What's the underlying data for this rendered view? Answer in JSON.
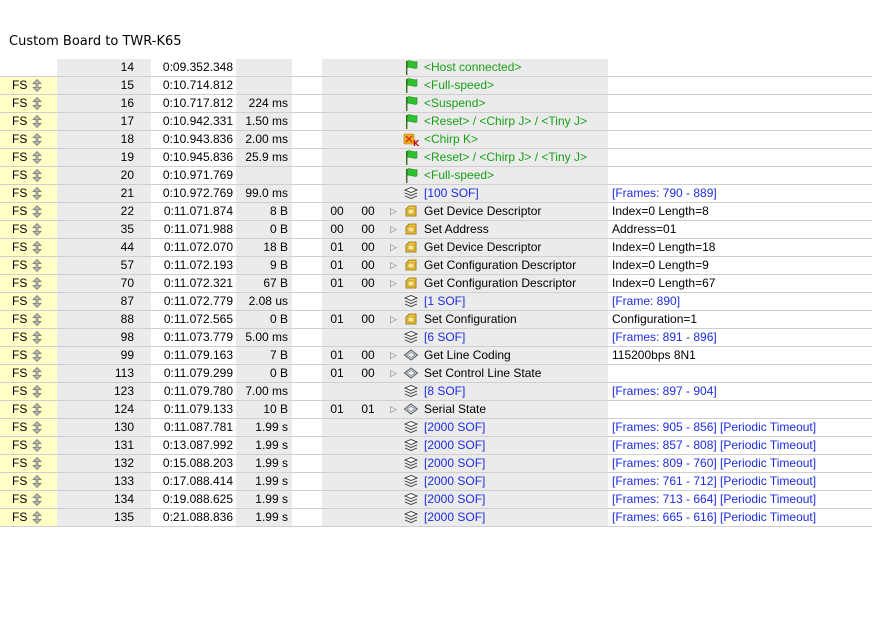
{
  "title": "Custom Board to TWR-K65",
  "rows": [
    {
      "sp": "",
      "idx": "14",
      "time": "0:09.352.348",
      "dur": "",
      "dev": "",
      "ep": "",
      "exp": false,
      "icon": "flag-icon",
      "rec": "<Host connected>",
      "recColor": "green",
      "sum": "",
      "sumColor": "black"
    },
    {
      "sp": "FS",
      "idx": "15",
      "time": "0:10.714.812",
      "dur": "",
      "dev": "",
      "ep": "",
      "exp": false,
      "icon": "flag-icon",
      "rec": "<Full-speed>",
      "recColor": "green",
      "sum": "",
      "sumColor": "black"
    },
    {
      "sp": "FS",
      "idx": "16",
      "time": "0:10.717.812",
      "dur": "224 ms",
      "dev": "",
      "ep": "",
      "exp": false,
      "icon": "flag-icon",
      "rec": "<Suspend>",
      "recColor": "green",
      "sum": "",
      "sumColor": "black"
    },
    {
      "sp": "FS",
      "idx": "17",
      "time": "0:10.942.331",
      "dur": "1.50 ms",
      "dev": "",
      "ep": "",
      "exp": false,
      "icon": "flag-icon",
      "rec": "<Reset> / <Chirp J> / <Tiny J>",
      "recColor": "green",
      "sum": "",
      "sumColor": "black"
    },
    {
      "sp": "FS",
      "idx": "18",
      "time": "0:10.943.836",
      "dur": "2.00 ms",
      "dev": "",
      "ep": "",
      "exp": false,
      "icon": "chirp-k-icon",
      "rec": "<Chirp K>",
      "recColor": "green",
      "sum": "",
      "sumColor": "black"
    },
    {
      "sp": "FS",
      "idx": "19",
      "time": "0:10.945.836",
      "dur": "25.9 ms",
      "dev": "",
      "ep": "",
      "exp": false,
      "icon": "flag-icon",
      "rec": "<Reset> / <Chirp J> / <Tiny J>",
      "recColor": "green",
      "sum": "",
      "sumColor": "black"
    },
    {
      "sp": "FS",
      "idx": "20",
      "time": "0:10.971.769",
      "dur": "",
      "dev": "",
      "ep": "",
      "exp": false,
      "icon": "flag-icon",
      "rec": "<Full-speed>",
      "recColor": "green",
      "sum": "",
      "sumColor": "black"
    },
    {
      "sp": "FS",
      "idx": "21",
      "time": "0:10.972.769",
      "dur": "99.0 ms",
      "dev": "",
      "ep": "",
      "exp": false,
      "icon": "sof-stack-icon",
      "rec": "[100 SOF]",
      "recColor": "blue",
      "sum": "[Frames: 790 - 889]",
      "sumColor": "blue"
    },
    {
      "sp": "FS",
      "idx": "22",
      "time": "0:11.071.874",
      "dur": "8 B",
      "dev": "00",
      "ep": "00",
      "exp": true,
      "icon": "control-transfer-icon",
      "rec": "Get Device Descriptor",
      "recColor": "black",
      "sum": "Index=0 Length=8",
      "sumColor": "black"
    },
    {
      "sp": "FS",
      "idx": "35",
      "time": "0:11.071.988",
      "dur": "0 B",
      "dev": "00",
      "ep": "00",
      "exp": true,
      "icon": "control-transfer-icon",
      "rec": "Set Address",
      "recColor": "black",
      "sum": "Address=01",
      "sumColor": "black"
    },
    {
      "sp": "FS",
      "idx": "44",
      "time": "0:11.072.070",
      "dur": "18 B",
      "dev": "01",
      "ep": "00",
      "exp": true,
      "icon": "control-transfer-icon",
      "rec": "Get Device Descriptor",
      "recColor": "black",
      "sum": "Index=0 Length=18",
      "sumColor": "black"
    },
    {
      "sp": "FS",
      "idx": "57",
      "time": "0:11.072.193",
      "dur": "9 B",
      "dev": "01",
      "ep": "00",
      "exp": true,
      "icon": "control-transfer-icon",
      "rec": "Get Configuration Descriptor",
      "recColor": "black",
      "sum": "Index=0 Length=9",
      "sumColor": "black"
    },
    {
      "sp": "FS",
      "idx": "70",
      "time": "0:11.072.321",
      "dur": "67 B",
      "dev": "01",
      "ep": "00",
      "exp": true,
      "icon": "control-transfer-icon",
      "rec": "Get Configuration Descriptor",
      "recColor": "black",
      "sum": "Index=0 Length=67",
      "sumColor": "black"
    },
    {
      "sp": "FS",
      "idx": "87",
      "time": "0:11.072.779",
      "dur": "2.08 us",
      "dev": "",
      "ep": "",
      "exp": false,
      "icon": "sof-stack-icon",
      "rec": "[1 SOF]",
      "recColor": "blue",
      "sum": "[Frame: 890]",
      "sumColor": "blue"
    },
    {
      "sp": "FS",
      "idx": "88",
      "time": "0:11.072.565",
      "dur": "0 B",
      "dev": "01",
      "ep": "00",
      "exp": true,
      "icon": "control-transfer-icon",
      "rec": "Set Configuration",
      "recColor": "black",
      "sum": "Configuration=1",
      "sumColor": "black"
    },
    {
      "sp": "FS",
      "idx": "98",
      "time": "0:11.073.779",
      "dur": "5.00 ms",
      "dev": "",
      "ep": "",
      "exp": false,
      "icon": "sof-stack-icon",
      "rec": "[6 SOF]",
      "recColor": "blue",
      "sum": "[Frames: 891 - 896]",
      "sumColor": "blue"
    },
    {
      "sp": "FS",
      "idx": "99",
      "time": "0:11.079.163",
      "dur": "7 B",
      "dev": "01",
      "ep": "00",
      "exp": true,
      "icon": "class-request-icon",
      "rec": "Get Line Coding",
      "recColor": "black",
      "sum": "115200bps 8N1",
      "sumColor": "black"
    },
    {
      "sp": "FS",
      "idx": "113",
      "time": "0:11.079.299",
      "dur": "0 B",
      "dev": "01",
      "ep": "00",
      "exp": true,
      "icon": "class-request-icon",
      "rec": "Set Control Line State",
      "recColor": "black",
      "sum": "",
      "sumColor": "black"
    },
    {
      "sp": "FS",
      "idx": "123",
      "time": "0:11.079.780",
      "dur": "7.00 ms",
      "dev": "",
      "ep": "",
      "exp": false,
      "icon": "sof-stack-icon",
      "rec": "[8 SOF]",
      "recColor": "blue",
      "sum": "[Frames: 897 - 904]",
      "sumColor": "blue"
    },
    {
      "sp": "FS",
      "idx": "124",
      "time": "0:11.079.133",
      "dur": "10 B",
      "dev": "01",
      "ep": "01",
      "exp": true,
      "icon": "class-request-icon",
      "rec": "Serial State",
      "recColor": "black",
      "sum": "",
      "sumColor": "black"
    },
    {
      "sp": "FS",
      "idx": "130",
      "time": "0:11.087.781",
      "dur": "1.99 s",
      "dev": "",
      "ep": "",
      "exp": false,
      "icon": "sof-stack-icon",
      "rec": "[2000 SOF]",
      "recColor": "blue",
      "sum": "[Frames: 905 - 856] [Periodic Timeout]",
      "sumColor": "blue"
    },
    {
      "sp": "FS",
      "idx": "131",
      "time": "0:13.087.992",
      "dur": "1.99 s",
      "dev": "",
      "ep": "",
      "exp": false,
      "icon": "sof-stack-icon",
      "rec": "[2000 SOF]",
      "recColor": "blue",
      "sum": "[Frames: 857 - 808] [Periodic Timeout]",
      "sumColor": "blue"
    },
    {
      "sp": "FS",
      "idx": "132",
      "time": "0:15.088.203",
      "dur": "1.99 s",
      "dev": "",
      "ep": "",
      "exp": false,
      "icon": "sof-stack-icon",
      "rec": "[2000 SOF]",
      "recColor": "blue",
      "sum": "[Frames: 809 - 760] [Periodic Timeout]",
      "sumColor": "blue"
    },
    {
      "sp": "FS",
      "idx": "133",
      "time": "0:17.088.414",
      "dur": "1.99 s",
      "dev": "",
      "ep": "",
      "exp": false,
      "icon": "sof-stack-icon",
      "rec": "[2000 SOF]",
      "recColor": "blue",
      "sum": "[Frames: 761 - 712] [Periodic Timeout]",
      "sumColor": "blue"
    },
    {
      "sp": "FS",
      "idx": "134",
      "time": "0:19.088.625",
      "dur": "1.99 s",
      "dev": "",
      "ep": "",
      "exp": false,
      "icon": "sof-stack-icon",
      "rec": "[2000 SOF]",
      "recColor": "blue",
      "sum": "[Frames: 713 - 664] [Periodic Timeout]",
      "sumColor": "blue"
    },
    {
      "sp": "FS",
      "idx": "135",
      "time": "0:21.088.836",
      "dur": "1.99 s",
      "dev": "",
      "ep": "",
      "exp": false,
      "icon": "sof-stack-icon",
      "rec": "[2000 SOF]",
      "recColor": "blue",
      "sum": "[Frames: 665 - 616] [Periodic Timeout]",
      "sumColor": "blue"
    }
  ],
  "colors": {
    "green": "#18a018",
    "blue": "#1c2ce0",
    "speed_col_bg": "#ffffc6",
    "shaded_col_bg": "#ebebeb"
  }
}
